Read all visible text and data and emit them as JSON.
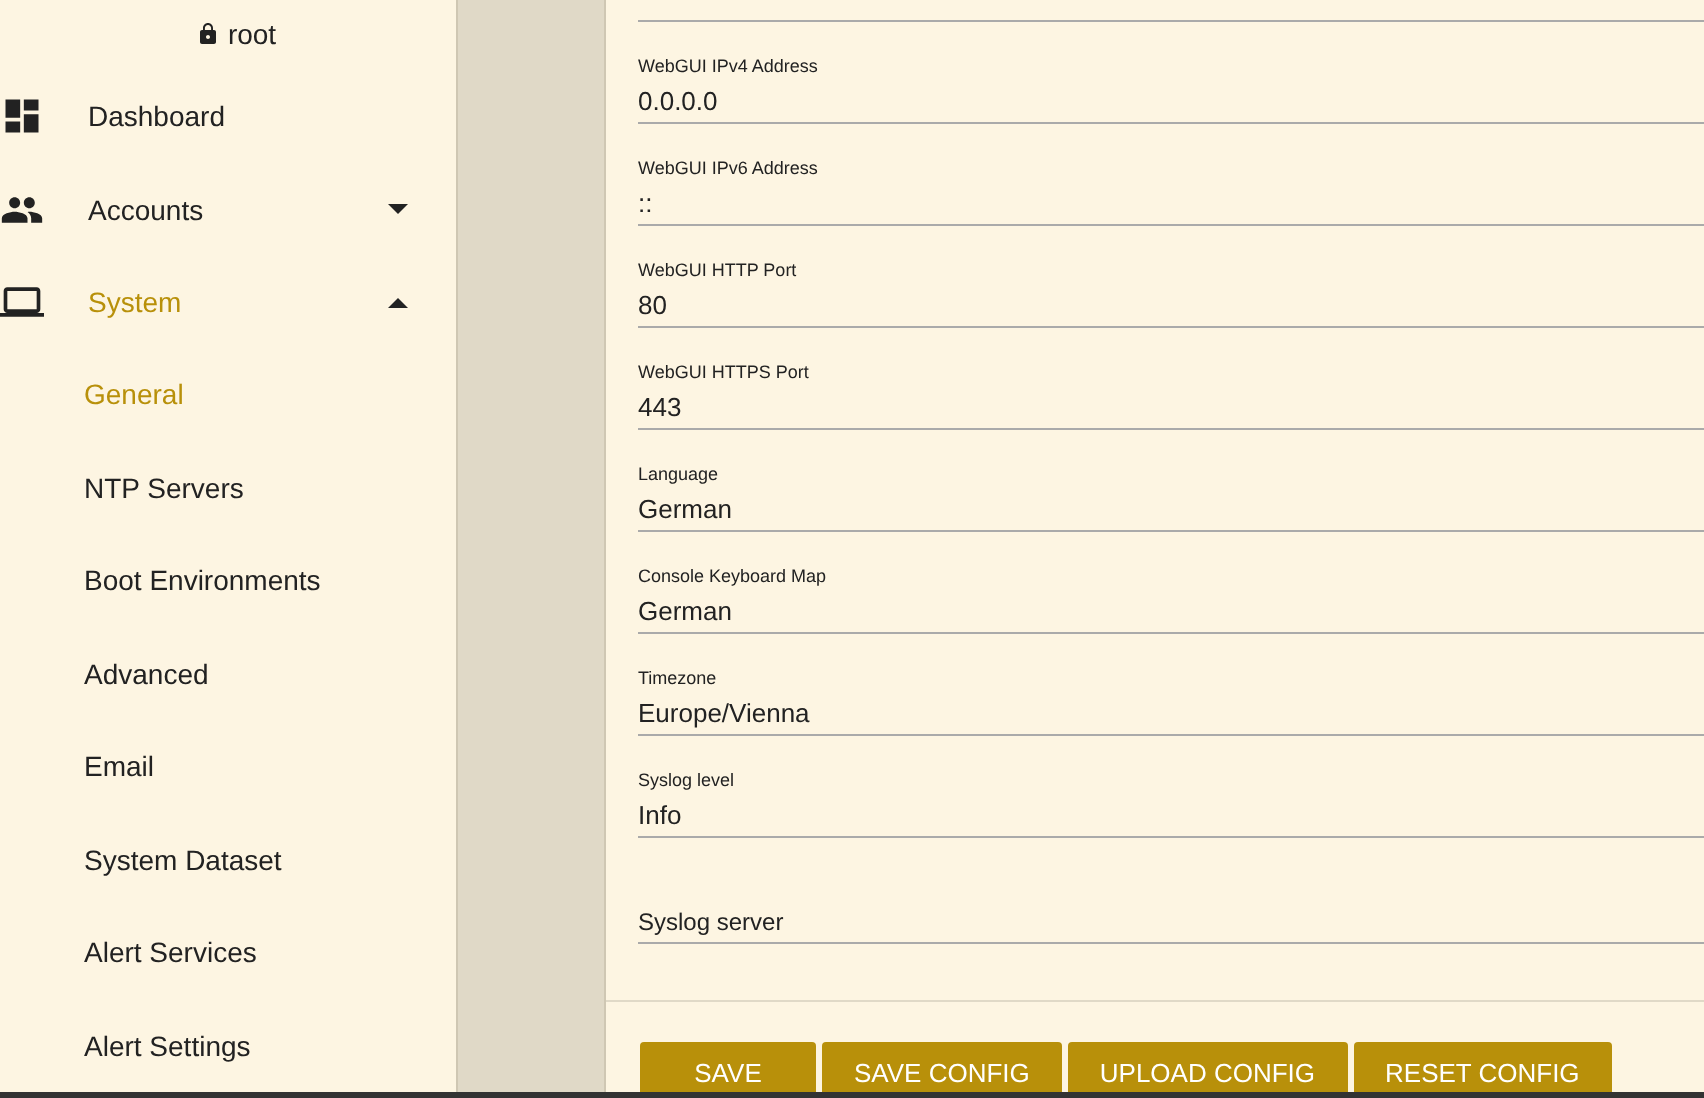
{
  "user": {
    "name": "root"
  },
  "sidebar": {
    "items": [
      {
        "label": "Dashboard",
        "selected": false
      },
      {
        "label": "Accounts",
        "selected": false,
        "expanded": false
      },
      {
        "label": "System",
        "selected": true,
        "expanded": true,
        "children": [
          {
            "label": "General",
            "selected": true
          },
          {
            "label": "NTP Servers",
            "selected": false
          },
          {
            "label": "Boot Environments",
            "selected": false
          },
          {
            "label": "Advanced",
            "selected": false
          },
          {
            "label": "Email",
            "selected": false
          },
          {
            "label": "System Dataset",
            "selected": false
          },
          {
            "label": "Alert Services",
            "selected": false
          },
          {
            "label": "Alert Settings",
            "selected": false
          }
        ]
      }
    ]
  },
  "form": {
    "fields": [
      {
        "label": "WebGUI IPv4 Address",
        "value": "0.0.0.0"
      },
      {
        "label": "WebGUI IPv6 Address",
        "value": "::"
      },
      {
        "label": "WebGUI HTTP Port",
        "value": "80"
      },
      {
        "label": "WebGUI HTTPS Port",
        "value": "443"
      },
      {
        "label": "Language",
        "value": "German"
      },
      {
        "label": "Console Keyboard Map",
        "value": "German"
      },
      {
        "label": "Timezone",
        "value": "Europe/Vienna"
      },
      {
        "label": "Syslog level",
        "value": "Info"
      },
      {
        "placeholder": "Syslog server"
      }
    ],
    "buttons": [
      "SAVE",
      "SAVE CONFIG",
      "UPLOAD CONFIG",
      "RESET CONFIG"
    ]
  }
}
